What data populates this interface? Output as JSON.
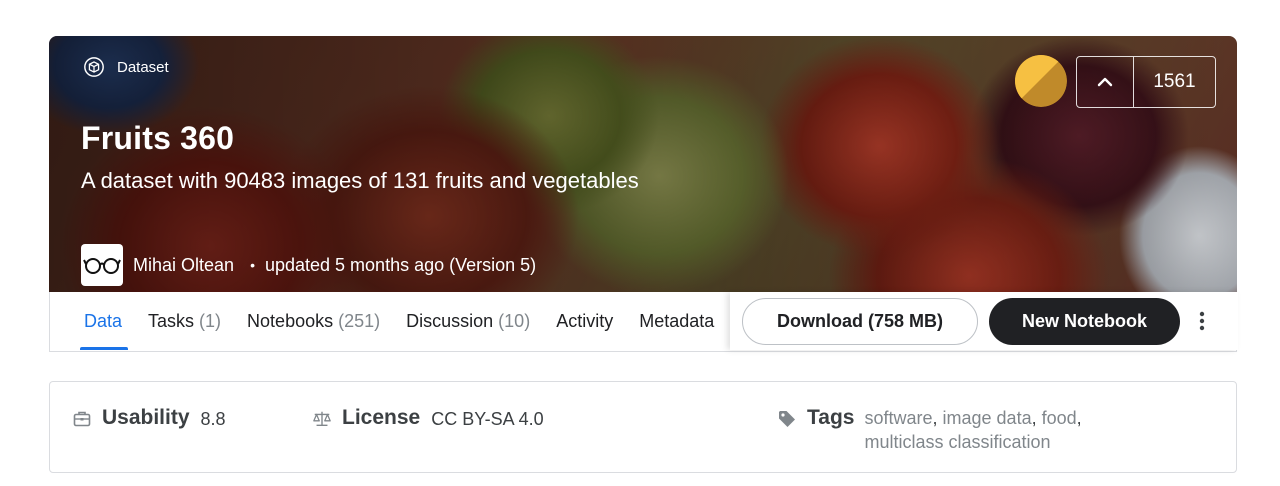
{
  "hero": {
    "type_label": "Dataset",
    "title": "Fruits 360",
    "subtitle": "A dataset with 90483 images of 131 fruits and vegetables",
    "author": "Mihai Oltean",
    "updated": "updated 5 months ago (Version 5)",
    "votes": "1561",
    "medal_color": "#f6c042"
  },
  "tabs": [
    {
      "label": "Data",
      "count": ""
    },
    {
      "label": "Tasks",
      "count": "(1)"
    },
    {
      "label": "Notebooks",
      "count": "(251)"
    },
    {
      "label": "Discussion",
      "count": "(10)"
    },
    {
      "label": "Activity",
      "count": ""
    },
    {
      "label": "Metadata",
      "count": ""
    }
  ],
  "actions": {
    "download_label": "Download (758 MB)",
    "new_notebook_label": "New Notebook"
  },
  "info": {
    "usability_label": "Usability",
    "usability_value": "8.8",
    "license_label": "License",
    "license_value": "CC BY-SA 4.0",
    "tags_label": "Tags",
    "tags": [
      "software",
      "image data",
      "food",
      "multiclass classification"
    ]
  },
  "colors": {
    "accent": "#1a73e8",
    "primary_button": "#202124"
  }
}
